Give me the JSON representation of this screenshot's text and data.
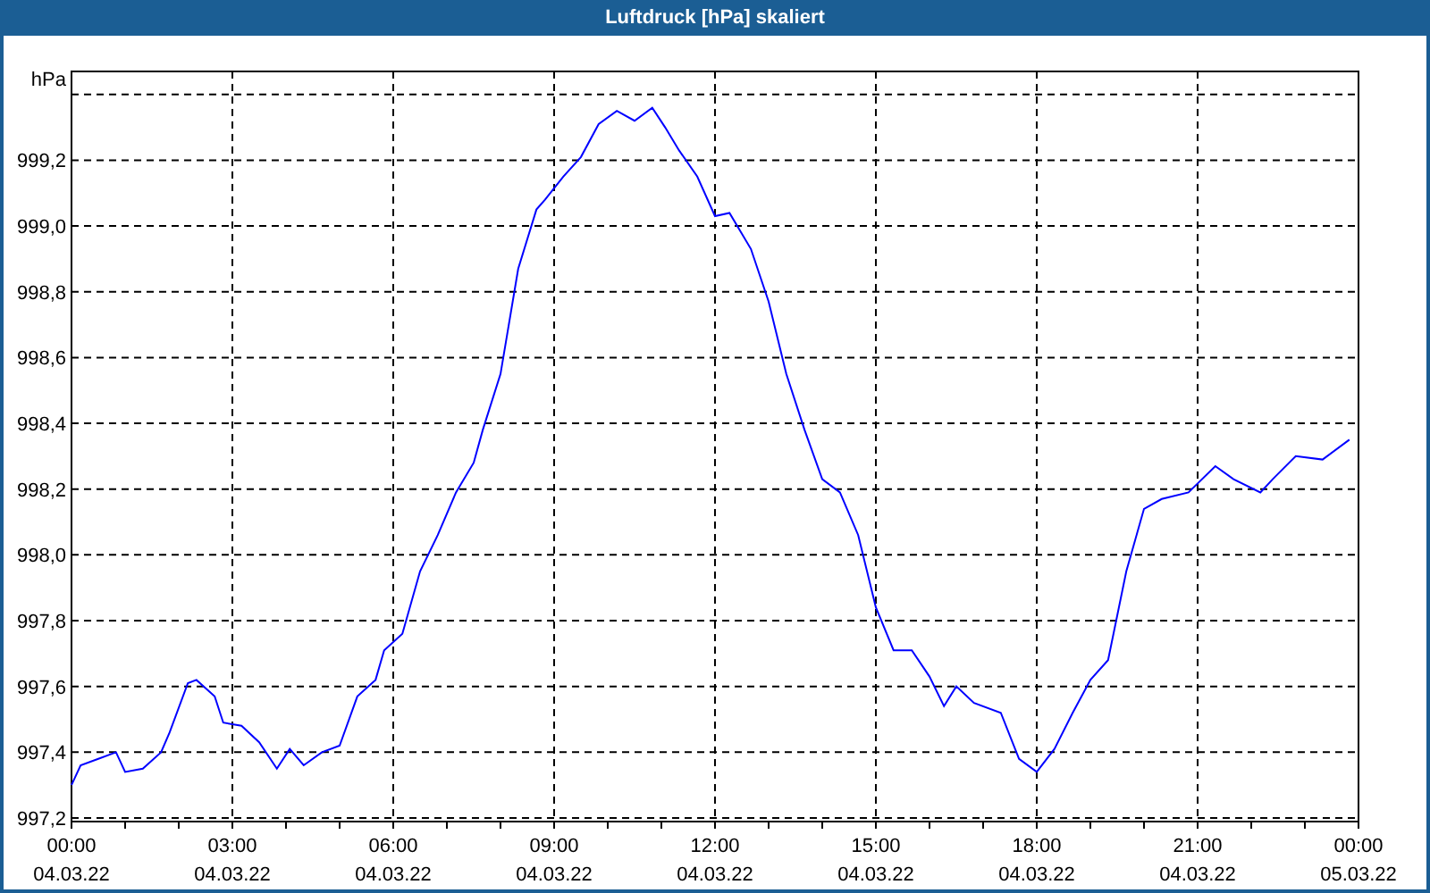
{
  "window": {
    "title": "Luftdruck [hPa] skaliert"
  },
  "chart": {
    "chart_data": {
      "type": "line",
      "grid": true,
      "ylabel": "hPa",
      "xlim": [
        0,
        24
      ],
      "ylim": [
        997.2,
        999.47
      ],
      "x": [
        0,
        0.17,
        0.5,
        0.83,
        1.0,
        1.33,
        1.67,
        1.83,
        2.17,
        2.33,
        2.67,
        2.83,
        3.17,
        3.5,
        3.83,
        4.07,
        4.33,
        4.67,
        5.0,
        5.33,
        5.67,
        5.83,
        6.17,
        6.5,
        6.83,
        7.17,
        7.5,
        7.67,
        8.0,
        8.33,
        8.67,
        8.83,
        9.17,
        9.5,
        9.83,
        10.17,
        10.5,
        10.83,
        11.07,
        11.33,
        11.67,
        12.0,
        12.27,
        12.67,
        13.0,
        13.33,
        13.67,
        14.0,
        14.33,
        14.67,
        15.0,
        15.33,
        15.67,
        16.0,
        16.27,
        16.5,
        16.83,
        17.33,
        17.67,
        18.0,
        18.33,
        18.67,
        19.0,
        19.33,
        19.67,
        20.0,
        20.33,
        20.83,
        21.33,
        21.67,
        22.17,
        22.4,
        22.83,
        23.33,
        23.83
      ],
      "series": [
        {
          "color": "#0000ff",
          "values": [
            997.3,
            997.36,
            997.38,
            997.4,
            997.34,
            997.35,
            997.4,
            997.46,
            997.61,
            997.62,
            997.57,
            997.49,
            997.48,
            997.43,
            997.35,
            997.41,
            997.36,
            997.4,
            997.42,
            997.57,
            997.62,
            997.71,
            997.76,
            997.95,
            998.06,
            998.19,
            998.28,
            998.38,
            998.55,
            998.87,
            999.05,
            999.08,
            999.15,
            999.21,
            999.31,
            999.35,
            999.32,
            999.36,
            999.3,
            999.23,
            999.15,
            999.03,
            999.04,
            998.93,
            998.77,
            998.55,
            998.38,
            998.23,
            998.19,
            998.06,
            997.84,
            997.71,
            997.71,
            997.63,
            997.54,
            997.6,
            997.55,
            997.52,
            997.38,
            997.34,
            997.41,
            997.52,
            997.62,
            997.68,
            997.95,
            998.14,
            998.17,
            998.19,
            998.27,
            998.23,
            998.19,
            998.23,
            998.3,
            998.29,
            998.35
          ]
        }
      ],
      "xticks": [
        {
          "value": 0,
          "label": "00:00"
        },
        {
          "value": 3,
          "label": "03:00"
        },
        {
          "value": 6,
          "label": "06:00"
        },
        {
          "value": 9,
          "label": "09:00"
        },
        {
          "value": 12,
          "label": "12:00"
        },
        {
          "value": 15,
          "label": "15:00"
        },
        {
          "value": 18,
          "label": "18:00"
        },
        {
          "value": 21,
          "label": "21:00"
        },
        {
          "value": 24,
          "label": "00:00"
        }
      ],
      "yticks": [
        {
          "value": 997.2,
          "label": "997,2"
        },
        {
          "value": 997.4,
          "label": "997,4"
        },
        {
          "value": 997.6,
          "label": "997,6"
        },
        {
          "value": 997.8,
          "label": "997,8"
        },
        {
          "value": 998.0,
          "label": "998,0"
        },
        {
          "value": 998.2,
          "label": "998,2"
        },
        {
          "value": 998.4,
          "label": "998,4"
        },
        {
          "value": 998.6,
          "label": "998,6"
        },
        {
          "value": 998.8,
          "label": "998,8"
        },
        {
          "value": 999.0,
          "label": "999,0"
        },
        {
          "value": 999.2,
          "label": "999,2"
        }
      ]
    },
    "x_dates": [
      "04.03.22",
      "04.03.22",
      "04.03.22",
      "04.03.22",
      "04.03.22",
      "04.03.22",
      "04.03.22",
      "04.03.22",
      "05.03.22"
    ]
  }
}
